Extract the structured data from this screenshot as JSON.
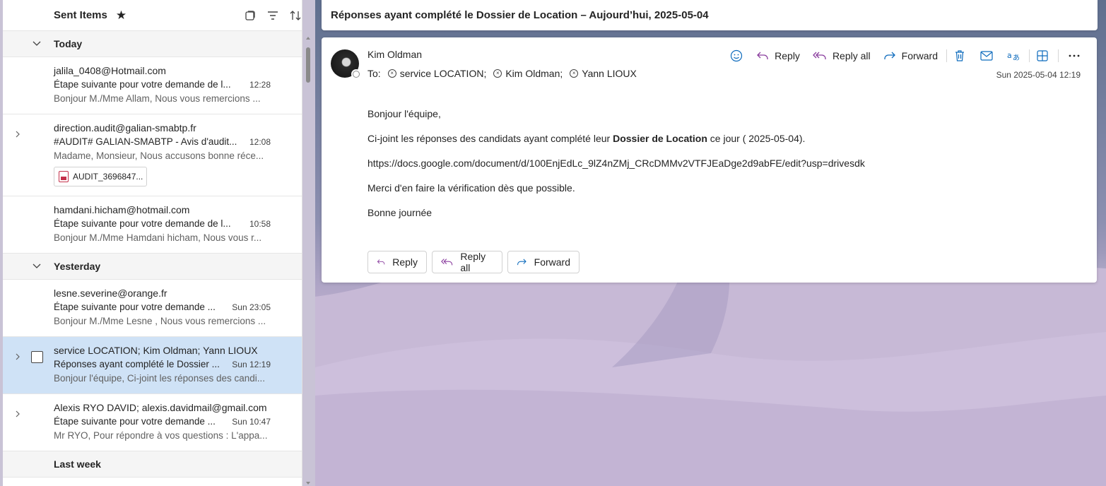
{
  "list": {
    "folder_title": "Sent Items",
    "groups": [
      {
        "label": "Today"
      },
      {
        "label": "Yesterday"
      },
      {
        "label": "Last week"
      }
    ],
    "items": [
      {
        "from": "jalila_0408@Hotmail.com",
        "subject": "Étape suivante pour votre demande de l...",
        "time": "12:28",
        "preview": "Bonjour M./Mme Allam, Nous vous remercions ..."
      },
      {
        "from": "direction.audit@galian-smabtp.fr",
        "subject": "#AUDIT# GALIAN-SMABTP - Avis d'audit...",
        "time": "12:08",
        "preview": "Madame, Monsieur, Nous accusons bonne réce...",
        "attachment": "AUDIT_3696847..."
      },
      {
        "from": "hamdani.hicham@hotmail.com",
        "subject": "Étape suivante pour votre demande de l...",
        "time": "10:58",
        "preview": "Bonjour M./Mme Hamdani hicham, Nous vous r..."
      },
      {
        "from": "lesne.severine@orange.fr",
        "subject": "Étape suivante pour votre demande ...",
        "time": "Sun 23:05",
        "preview": "Bonjour M./Mme Lesne , Nous vous remercions ..."
      },
      {
        "from": "service LOCATION; Kim Oldman; Yann LIOUX",
        "subject": "Réponses ayant complété le Dossier ...",
        "time": "Sun 12:19",
        "preview": "Bonjour l'équipe, Ci-joint les réponses des candi..."
      },
      {
        "from": "Alexis RYO DAVID; alexis.davidmail@gmail.com",
        "subject": "Étape suivante pour votre demande ...",
        "time": "Sun 10:47",
        "preview": "Mr RYO, Pour répondre à vos questions : L'appa..."
      }
    ]
  },
  "message": {
    "subject": "Réponses ayant complété le Dossier de Location – Aujourd’hui, 2025-05-04",
    "sender": "Kim Oldman",
    "to_label": "To:",
    "recipients": [
      "service LOCATION;",
      "Kim Oldman;",
      "Yann LIOUX"
    ],
    "date": "Sun 2025-05-04 12:19",
    "actions": {
      "reply": "Reply",
      "reply_all": "Reply all",
      "forward": "Forward"
    },
    "body": {
      "greeting": "Bonjour l'équipe,",
      "line1_pre": "Ci-joint les réponses des candidats ayant complété leur ",
      "line1_bold": "Dossier de Location",
      "line1_post": " ce jour ( 2025-05-04).",
      "link": "https://docs.google.com/document/d/100EnjEdLc_9lZ4nZMj_CRcDMMv2VTFJEaDge2d9abFE/edit?usp=drivesdk",
      "line3": "Merci d'en faire la vérification dès que possible.",
      "closing": "Bonne journée"
    }
  },
  "colors": {
    "accent": "#0f6cbd",
    "selected_row": "#cfe2f6",
    "reply_all_icon": "#8a3d9e"
  }
}
